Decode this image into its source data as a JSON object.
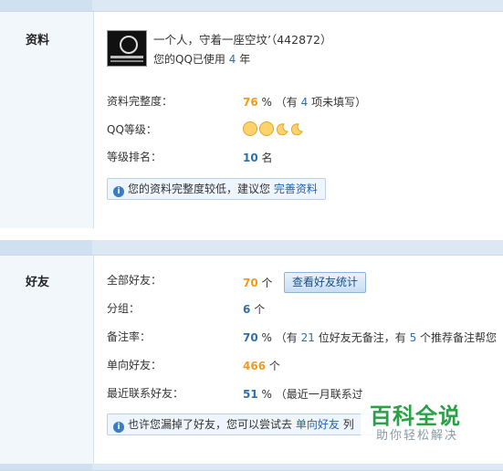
{
  "profile": {
    "section_title": "资料",
    "nickname": "一个人，守着一座空坟’",
    "qq_number": "（442872）",
    "years_prefix": "您的QQ已使用",
    "years": "4",
    "years_suffix": "年",
    "completeness_label": "资料完整度：",
    "completeness_value": "76",
    "completeness_unit": "%",
    "completeness_note_prefix": "（有",
    "completeness_missing": "4",
    "completeness_note_suffix": "项未填写）",
    "level_label": "QQ等级：",
    "level_icons": [
      "sun-icon",
      "sun-icon",
      "moon-icon",
      "moon-icon"
    ],
    "rank_label": "等级排名：",
    "rank_value": "10",
    "rank_unit": "名",
    "notice_text": "您的资料完整度较低，建议您",
    "notice_link": "完善资料"
  },
  "friends": {
    "section_title": "好友",
    "all_label": "全部好友：",
    "all_value": "70",
    "all_unit": "个",
    "stats_button": "查看好友统计",
    "groups_label": "分组：",
    "groups_value": "6",
    "groups_unit": "个",
    "remark_label": "备注率：",
    "remark_value": "70",
    "remark_unit": "%",
    "remark_note_a": "（有",
    "remark_unremarked": "21",
    "remark_note_b": "位好友无备注，有",
    "remark_recommend": "5",
    "remark_note_c": "个推荐备注帮您",
    "oneway_label": "单向好友：",
    "oneway_value": "466",
    "oneway_unit": "个",
    "recent_label": "最近联系好友：",
    "recent_value": "51",
    "recent_unit": "%",
    "recent_note": "（最近一月联系过",
    "notice_text": "也许您漏掉了好友，您可以尝试去",
    "notice_link": "单向好友",
    "notice_tail": "列"
  },
  "watermark": {
    "title": "百科全说",
    "subtitle": "助你轻松解决"
  },
  "colors": {
    "accent_orange": "#f29a1b",
    "accent_blue": "#2d6fb0",
    "band": "#dce9f5",
    "watermark_green": "#2aa146"
  }
}
